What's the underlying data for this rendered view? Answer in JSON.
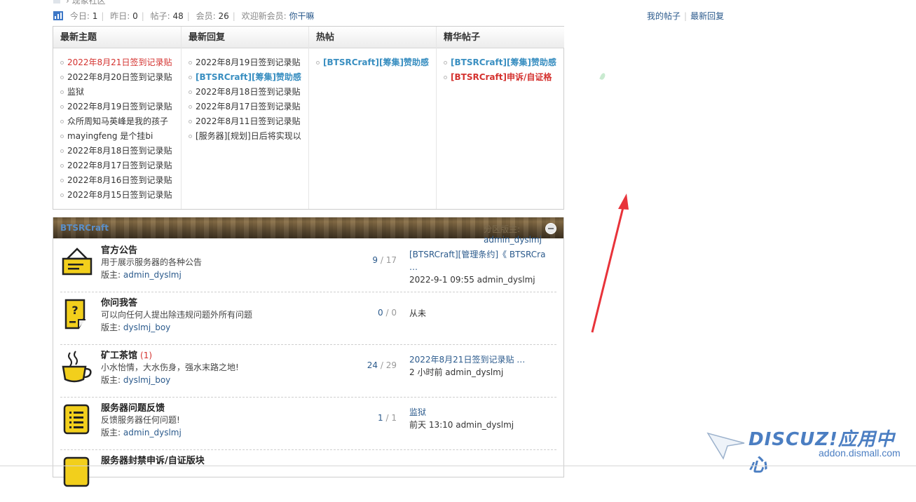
{
  "breadcrumb": {
    "current": "现象社区"
  },
  "stats": {
    "today_label": "今日:",
    "today": "1",
    "yesterday_label": "昨日:",
    "yesterday": "0",
    "posts_label": "帖子:",
    "posts": "48",
    "members_label": "会员:",
    "members": "26",
    "welcome_label": "欢迎新会员:",
    "new_member": "你干嘛",
    "my_posts": "我的帖子",
    "latest_replies": "最新回复"
  },
  "grid": {
    "columns": [
      {
        "title": "最新主题",
        "items": [
          {
            "text": "2022年8月21日签到记录贴",
            "style": "red"
          },
          {
            "text": "2022年8月20日签到记录贴",
            "style": ""
          },
          {
            "text": "监狱",
            "style": ""
          },
          {
            "text": "2022年8月19日签到记录贴",
            "style": ""
          },
          {
            "text": "众所周知马英峰是我的孩子",
            "style": ""
          },
          {
            "text": "mayingfeng 是个挂bi",
            "style": ""
          },
          {
            "text": "2022年8月18日签到记录贴",
            "style": ""
          },
          {
            "text": "2022年8月17日签到记录贴",
            "style": ""
          },
          {
            "text": "2022年8月16日签到记录贴",
            "style": ""
          },
          {
            "text": "2022年8月15日签到记录贴",
            "style": ""
          }
        ]
      },
      {
        "title": "最新回复",
        "items": [
          {
            "text": "2022年8月19日签到记录贴",
            "style": ""
          },
          {
            "text": "[BTSRCraft][筹集]赞助感",
            "style": "blue"
          },
          {
            "text": "2022年8月18日签到记录贴",
            "style": ""
          },
          {
            "text": "2022年8月17日签到记录贴",
            "style": ""
          },
          {
            "text": "2022年8月11日签到记录贴",
            "style": ""
          },
          {
            "text": "[服务器][规划]日后将实现以",
            "style": ""
          }
        ]
      },
      {
        "title": "热帖",
        "items": [
          {
            "text": "[BTSRCraft][筹集]赞助感",
            "style": "blue"
          }
        ]
      },
      {
        "title": "精华帖子",
        "items": [
          {
            "text": "[BTSRCraft][筹集]赞助感",
            "style": "blue"
          },
          {
            "text": "[BTSRCraft]申诉/自证格",
            "style": "redb"
          }
        ]
      }
    ]
  },
  "forum_group": {
    "title": "BTSRCraft",
    "moderator_label": "分区版主:",
    "moderator": "admin_dyslmj",
    "forums": [
      {
        "name": "官方公告",
        "today": "",
        "desc": "用于展示服务器的各种公告",
        "mod_label": "版主:",
        "mod": "admin_dyslmj",
        "threads": "9",
        "posts": "17",
        "last_title": "[BTSRCraft][管理条约]《 BTSRCra …",
        "last_info": "2022-9-1 09:55 admin_dyslmj",
        "icon": "sign-icon"
      },
      {
        "name": "你问我答",
        "today": "",
        "desc": "可以向任何人提出除违规问题外所有问题",
        "mod_label": "版主:",
        "mod": "dyslmj_boy",
        "threads": "0",
        "posts": "0",
        "last_title": "",
        "last_info": "从未",
        "icon": "question-doc-icon"
      },
      {
        "name": "矿工茶馆",
        "today": "(1)",
        "desc": "小水怡情，大水伤身，强水末路之地!",
        "mod_label": "版主:",
        "mod": "dyslmj_boy",
        "threads": "24",
        "posts": "29",
        "last_title": "2022年8月21日签到记录贴 …",
        "last_info": "2 小时前 admin_dyslmj",
        "icon": "teacup-icon"
      },
      {
        "name": "服务器问题反馈",
        "today": "",
        "desc": "反馈服务器任何问题!",
        "mod_label": "版主:",
        "mod": "admin_dyslmj",
        "threads": "1",
        "posts": "1",
        "last_title": "监狱",
        "last_info": "前天 13:10 admin_dyslmj",
        "icon": "notebook-icon"
      },
      {
        "name": "服务器封禁申诉/自证版块",
        "today": "",
        "desc": "",
        "mod_label": "",
        "mod": "",
        "threads": "",
        "posts": "",
        "last_title": "",
        "last_info": "",
        "icon": "notebook-icon"
      }
    ]
  },
  "watermark": {
    "brand": "DISCUZ!应用中心",
    "domain": "addon.dismall.com"
  },
  "colors": {
    "link": "#2b5a8c",
    "accent_red": "#d4322f",
    "accent_blue": "#3a8fc1",
    "icon_yellow": "#f2cf1c"
  }
}
